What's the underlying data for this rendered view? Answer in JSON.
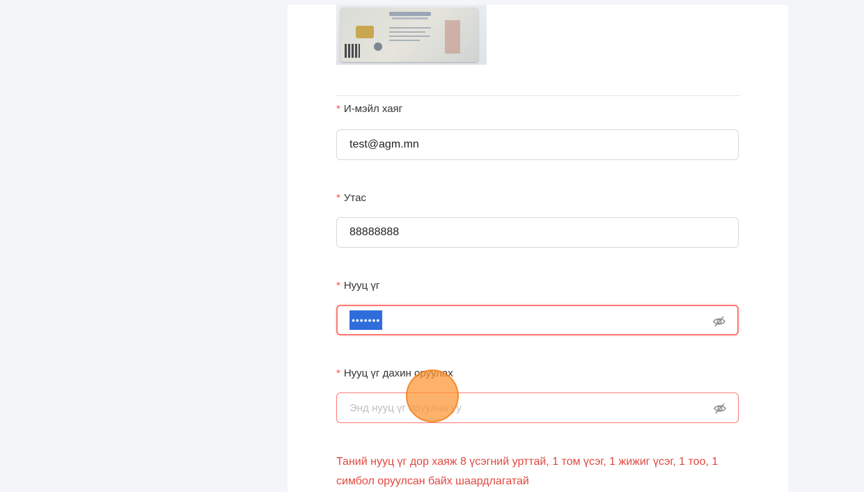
{
  "form": {
    "email": {
      "label": "И-мэйл хаяг",
      "value": "test@agm.mn"
    },
    "phone": {
      "label": "Утас",
      "value": "88888888"
    },
    "password": {
      "label": "Нууц үг",
      "value": "•••••••"
    },
    "confirm_password": {
      "label": "Нууц үг дахин оруулах",
      "placeholder": "Энд нууц үг оруулна уу"
    },
    "required_mark": "*",
    "error_message": "Таний нууц үг дор хаяж 8 үсэгний урттай, 1 том үсэг, 1 жижиг үсэг, 1 тоо, 1 симбол оруулсан байх шаардлагатай"
  },
  "colors": {
    "required": "#ff4d4f",
    "error": "#e0483f",
    "selection": "#2f6ddc",
    "cursor": "#fc9432"
  },
  "icons": {
    "password_toggle": "eye-slash-icon"
  }
}
